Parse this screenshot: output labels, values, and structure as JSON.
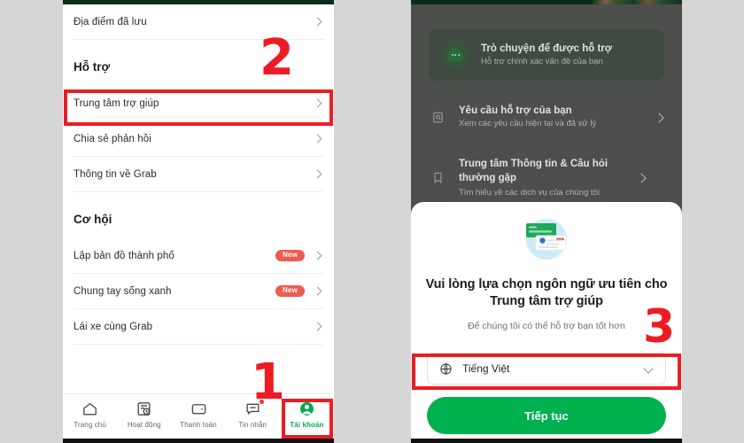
{
  "left_screen": {
    "items_top": [
      {
        "label": "Địa điểm đã lưu",
        "icon": "chevron-right-icon"
      }
    ],
    "section_support": {
      "heading": "Hỗ trợ",
      "items": [
        {
          "label": "Trung tâm trợ giúp",
          "icon": "chevron-right-icon"
        },
        {
          "label": "Chia sẻ phản hồi",
          "icon": "chevron-right-icon"
        },
        {
          "label": "Thông tin về Grab",
          "icon": "chevron-right-icon"
        }
      ]
    },
    "section_opportunity": {
      "heading": "Cơ hội",
      "items": [
        {
          "label": "Lập bản đồ thành phố",
          "badge": "New",
          "icon": "chevron-right-icon"
        },
        {
          "label": "Chung tay sống xanh",
          "badge": "New",
          "icon": "chevron-right-icon"
        },
        {
          "label": "Lái xe cùng Grab",
          "badge": "",
          "icon": "chevron-right-icon"
        }
      ]
    },
    "tabbar": [
      {
        "label": "Trang chủ",
        "icon": "home-icon",
        "active": false
      },
      {
        "label": "Hoạt động",
        "icon": "activity-icon",
        "active": false
      },
      {
        "label": "Thanh toán",
        "icon": "wallet-icon",
        "active": false
      },
      {
        "label": "Tin nhắn",
        "icon": "message-icon",
        "active": false,
        "badge_dot": true
      },
      {
        "label": "Tài khoản",
        "icon": "account-icon",
        "active": true
      }
    ]
  },
  "right_screen": {
    "chat_card": {
      "title": "Trò chuyện để được hỗ trợ",
      "subtitle": "Hỗ trợ chính xác vấn đề của bạn",
      "icon": "chat-bubble-icon"
    },
    "rows": [
      {
        "title": "Yêu cầu hỗ trợ của bạn",
        "subtitle": "Xem các yêu cầu hiện tại và đã xử lý",
        "icon": "ticket-icon",
        "chevron": "chevron-right-icon"
      },
      {
        "title": "Trung tâm Thông tin & Câu hỏi thường gặp",
        "subtitle": "Tìm hiểu về các dịch vụ của chúng tôi",
        "icon": "bookmark-icon",
        "chevron": "chevron-right-icon"
      }
    ],
    "sheet": {
      "illustration": "chat-cards-illustration",
      "title": "Vui lòng lựa chọn ngôn ngữ ưu tiên cho Trung tâm trợ giúp",
      "subtitle": "Để chúng tôi có thể hỗ trợ bạn tốt hơn",
      "language_select": {
        "icon": "globe-icon",
        "value": "Tiếng Việt",
        "chevron": "chevron-down-icon"
      },
      "cta_label": "Tiếp tục"
    }
  },
  "annotations": {
    "step_1": "1",
    "step_2": "2",
    "step_3": "3",
    "color": "#ed1c24"
  },
  "colors": {
    "brand_green": "#00b14f",
    "accent_red": "#ed1c24",
    "badge_red": "#ee5b4f",
    "page_bg": "#d6d6d6"
  }
}
